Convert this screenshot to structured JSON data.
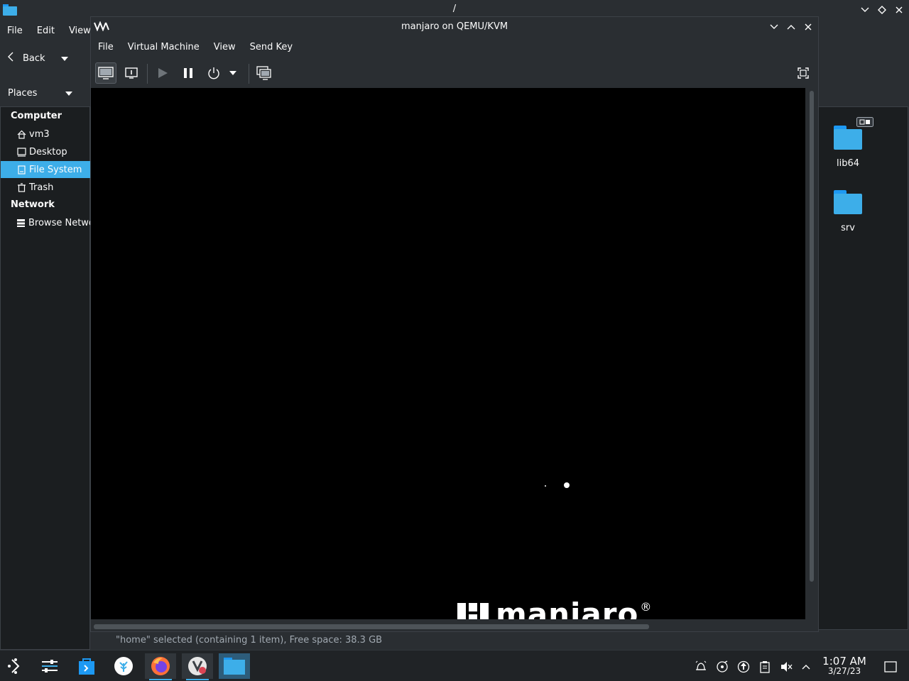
{
  "dolphin": {
    "title": "/",
    "menu": [
      "File",
      "Edit",
      "View"
    ],
    "back_label": "Back",
    "places_label": "Places",
    "sidebar": {
      "computer_header": "Computer",
      "items": [
        {
          "label": "vm3",
          "icon": "home-icon"
        },
        {
          "label": "Desktop",
          "icon": "desktop-icon"
        },
        {
          "label": "File System",
          "icon": "drive-icon",
          "selected": true
        },
        {
          "label": "Trash",
          "icon": "trash-icon"
        }
      ],
      "network_header": "Network",
      "network_items": [
        {
          "label": "Browse Network",
          "icon": "network-icon"
        }
      ]
    },
    "files": [
      {
        "name": "lib64"
      },
      {
        "name": "srv"
      }
    ],
    "status": "\"home\" selected (containing 1 item), Free space: 38.3 GB"
  },
  "vm": {
    "title": "manjaro on QEMU/KVM",
    "menu": [
      "File",
      "Virtual Machine",
      "View",
      "Send Key"
    ],
    "brand_text": "manjaro",
    "brand_reg": "®"
  },
  "taskbar": {
    "time": "1:07 AM",
    "date": "3/27/23"
  },
  "colors": {
    "accent": "#3daee9",
    "window_bg": "#2a2e32",
    "view_bg": "#1b1e20"
  }
}
